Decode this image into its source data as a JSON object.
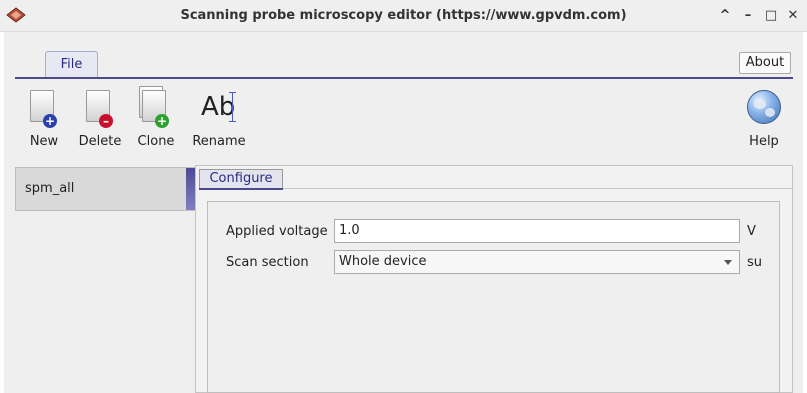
{
  "window": {
    "title": "Scanning probe microscopy editor (https://www.gpvdm.com)",
    "controls": {
      "collapse": "^",
      "minimize": "–",
      "maximize": "□",
      "close": "✕"
    }
  },
  "ribbon": {
    "tabs": [
      {
        "label": "File",
        "active": true
      }
    ],
    "about_label": "About"
  },
  "toolbar": {
    "items": [
      {
        "label": "New",
        "icon": "new-document-icon"
      },
      {
        "label": "Delete",
        "icon": "delete-document-icon"
      },
      {
        "label": "Clone",
        "icon": "clone-document-icon"
      },
      {
        "label": "Rename",
        "icon": "rename-text-icon",
        "icon_text": "Ab"
      },
      {
        "label": "Help",
        "icon": "help-globe-icon"
      }
    ]
  },
  "sidebar": {
    "items": [
      {
        "label": "spm_all",
        "selected": true
      }
    ]
  },
  "main": {
    "tabs": [
      {
        "label": "Configure",
        "active": true
      }
    ],
    "fields": [
      {
        "label": "Applied voltage",
        "value": "1.0",
        "unit": "V",
        "type": "text"
      },
      {
        "label": "Scan section",
        "value": "Whole device",
        "unit": "su",
        "type": "select"
      }
    ]
  },
  "colors": {
    "accent": "#4a4a8c",
    "tab_text": "#2a2a80",
    "new_badge": "#2a3fb0",
    "delete_badge": "#c8102e",
    "clone_badge": "#2da12d"
  }
}
